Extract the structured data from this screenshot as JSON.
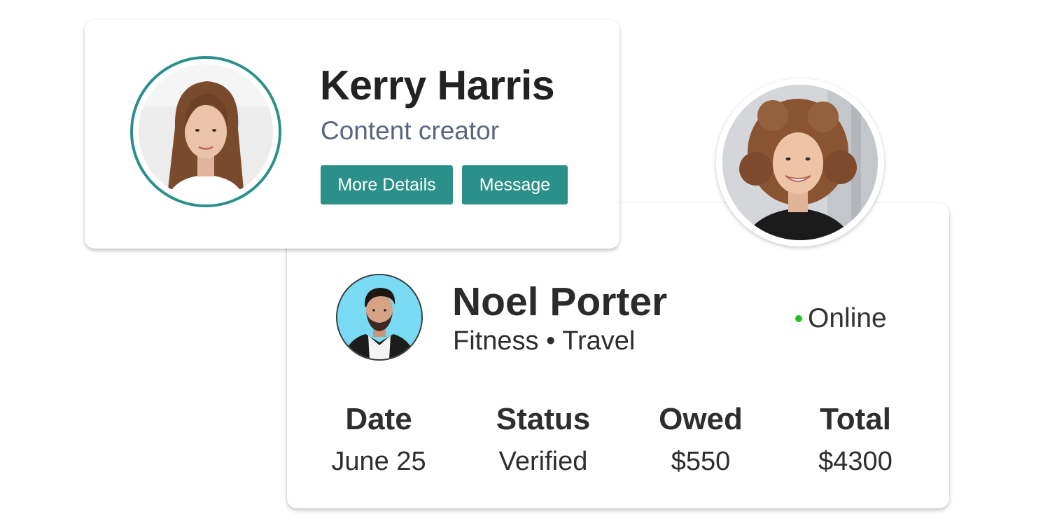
{
  "kerry_card": {
    "name": "Kerry Harris",
    "role": "Content creator",
    "buttons": {
      "more_details": "More Details",
      "message": "Message"
    },
    "accent_color": "#2a9089"
  },
  "noel_card": {
    "name": "Noel Porter",
    "tags": "Fitness • Travel",
    "status": "Online",
    "status_color": "#22c21d",
    "stats": [
      {
        "label": "Date",
        "value": "June 25"
      },
      {
        "label": "Status",
        "value": "Verified"
      },
      {
        "label": "Owed",
        "value": "$550"
      },
      {
        "label": "Total",
        "value": "$4300"
      }
    ]
  }
}
